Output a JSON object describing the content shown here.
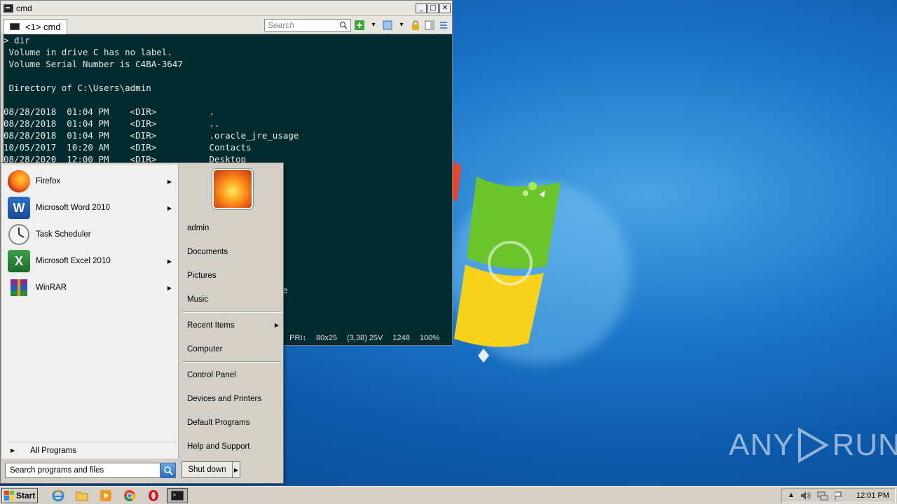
{
  "console": {
    "title": "cmd",
    "tab_label": "<1> cmd",
    "search_placeholder": "Search",
    "lines": [
      "> dir",
      " Volume in drive C has no label.",
      " Volume Serial Number is C4BA-3647",
      "",
      " Directory of C:\\Users\\admin",
      "",
      "08/28/2018  01:04 PM    <DIR>          .",
      "08/28/2018  01:04 PM    <DIR>          ..",
      "08/28/2018  01:04 PM    <DIR>          .oracle_jre_usage",
      "10/05/2017  10:20 AM    <DIR>          Contacts",
      "08/28/2020  12:00 PM    <DIR>          Desktop"
    ],
    "partial_text": "e",
    "status": {
      "mode": "PRI↕",
      "size": "80x25",
      "position": "(3,38) 25V",
      "buffer": "1248",
      "zoom": "100%"
    }
  },
  "start_menu": {
    "programs": [
      {
        "label": "Firefox",
        "icon": "firefox-icon",
        "has_submenu": true
      },
      {
        "label": "Microsoft Word 2010",
        "icon": "word-icon",
        "has_submenu": true
      },
      {
        "label": "Task Scheduler",
        "icon": "task-scheduler-icon",
        "has_submenu": false
      },
      {
        "label": "Microsoft Excel 2010",
        "icon": "excel-icon",
        "has_submenu": true
      },
      {
        "label": "WinRAR",
        "icon": "winrar-icon",
        "has_submenu": true
      }
    ],
    "all_programs": "All Programs",
    "search_placeholder": "Search programs and files",
    "right_items": {
      "user": "admin",
      "documents": "Documents",
      "pictures": "Pictures",
      "music": "Music",
      "recent_items": "Recent Items",
      "computer": "Computer",
      "control_panel": "Control Panel",
      "devices_printers": "Devices and Printers",
      "default_programs": "Default Programs",
      "help_support": "Help and Support"
    },
    "shutdown": "Shut down"
  },
  "taskbar": {
    "start_label": "Start",
    "pinned": [
      "internet-explorer-icon",
      "folder-icon",
      "media-player-icon",
      "chrome-icon",
      "opera-icon",
      "cmd-icon"
    ],
    "clock": "12:01 PM"
  },
  "watermark": {
    "text_left": "ANY",
    "text_right": "RUN"
  }
}
